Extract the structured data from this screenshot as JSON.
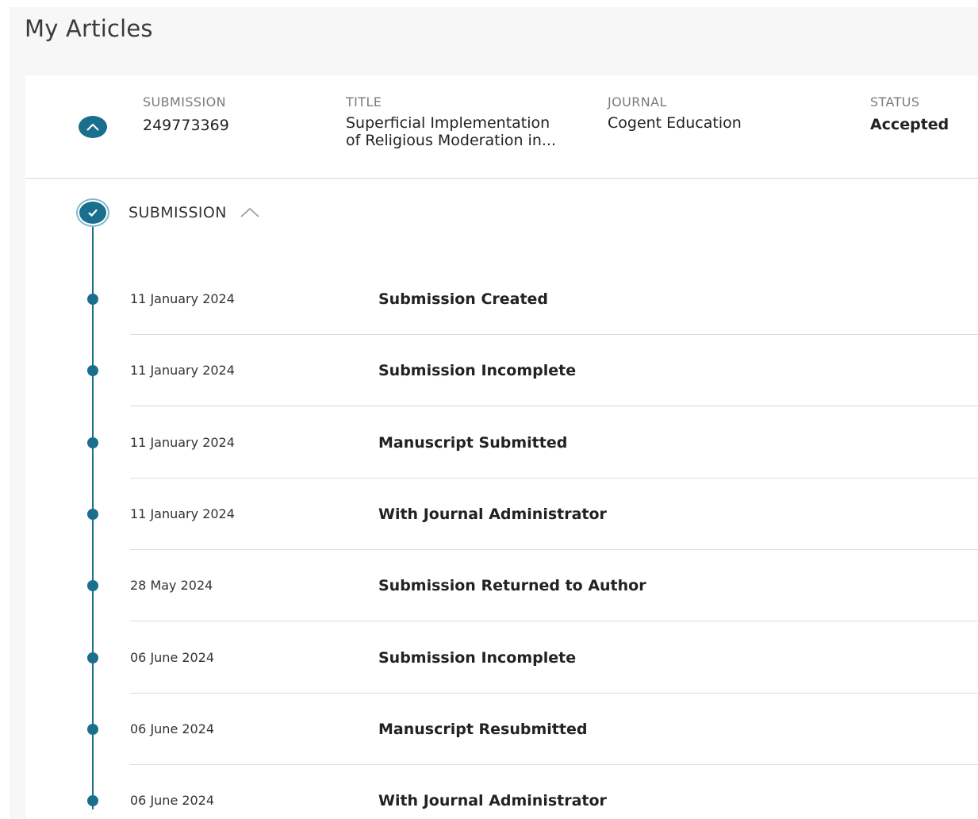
{
  "page": {
    "title": "My Articles"
  },
  "article": {
    "columns": {
      "submission": {
        "label": "SUBMISSION",
        "value": "249773369"
      },
      "title": {
        "label": "TITLE",
        "line1": "Superficial Implementation",
        "line2": "of Religious Moderation in..."
      },
      "journal": {
        "label": "JOURNAL",
        "value": "Cogent Education"
      },
      "status": {
        "label": "STATUS",
        "value": "Accepted"
      }
    },
    "collapse_icon": "chevron-up-icon"
  },
  "timeline": {
    "section_label": "SUBMISSION",
    "check_icon": "check-icon",
    "events": [
      {
        "date": "11 January 2024",
        "label": "Submission Created"
      },
      {
        "date": "11 January 2024",
        "label": "Submission Incomplete"
      },
      {
        "date": "11 January 2024",
        "label": "Manuscript Submitted"
      },
      {
        "date": "11 January 2024",
        "label": "With Journal Administrator"
      },
      {
        "date": "28 May 2024",
        "label": "Submission Returned to Author"
      },
      {
        "date": "06 June 2024",
        "label": "Submission Incomplete"
      },
      {
        "date": "06 June 2024",
        "label": "Manuscript Resubmitted"
      },
      {
        "date": "06 June 2024",
        "label": "With Journal Administrator"
      }
    ]
  },
  "colors": {
    "accent": "#1b6f8e",
    "background": "#f7f7f7",
    "divider": "#dcdcdc"
  }
}
